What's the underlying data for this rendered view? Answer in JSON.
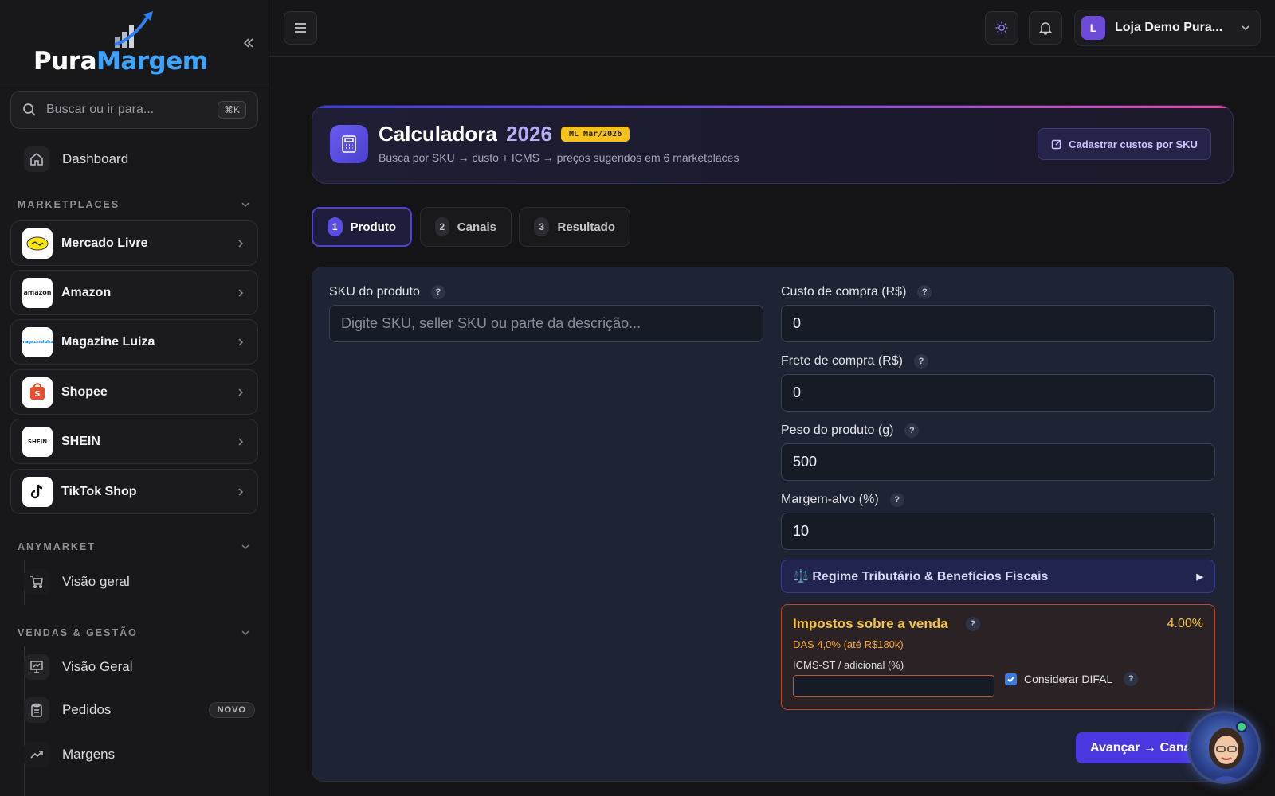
{
  "brand": {
    "part1": "Pura",
    "part2": "Margem"
  },
  "search": {
    "placeholder": "Buscar ou ir para...",
    "shortcut": "⌘K"
  },
  "nav": {
    "dashboard": "Dashboard"
  },
  "sections": {
    "marketplaces": "MARKETPLACES",
    "anymarket": "ANYMARKET",
    "vendas": "VENDAS & GESTÃO"
  },
  "marketplaces": [
    {
      "name": "Mercado Livre",
      "logo": "mercado livre"
    },
    {
      "name": "Amazon",
      "logo": "amazon"
    },
    {
      "name": "Magazine Luiza",
      "logo": "magazineluiza"
    },
    {
      "name": "Shopee",
      "logo": "Shopee"
    },
    {
      "name": "SHEIN",
      "logo": "SHEIN"
    },
    {
      "name": "TikTok Shop",
      "logo": "TikTok"
    }
  ],
  "anymarket_items": [
    {
      "label": "Visão geral"
    }
  ],
  "vendas_items": [
    {
      "label": "Visão Geral"
    },
    {
      "label": "Pedidos",
      "badge": "NOVO"
    },
    {
      "label": "Margens"
    }
  ],
  "topbar": {
    "store_initial": "L",
    "store_name": "Loja Demo Pura..."
  },
  "calc": {
    "title": "Calculadora",
    "year": "2026",
    "badge": "ML Mar/2026",
    "subtitle": "Busca por SKU → custo + ICMS → preços sugeridos em 6 marketplaces",
    "cadastrar": "Cadastrar custos por SKU"
  },
  "steps": [
    {
      "num": "1",
      "label": "Produto"
    },
    {
      "num": "2",
      "label": "Canais"
    },
    {
      "num": "3",
      "label": "Resultado"
    }
  ],
  "form": {
    "sku_label": "SKU do produto",
    "sku_placeholder": "Digite SKU, seller SKU ou parte da descrição...",
    "custo_label": "Custo de compra (R$)",
    "custo_value": "0",
    "frete_label": "Frete de compra (R$)",
    "frete_value": "0",
    "peso_label": "Peso do produto (g)",
    "peso_value": "500",
    "margem_label": "Margem-alvo (%)",
    "margem_value": "10",
    "regime_label": "⚖️ Regime Tributário & Benefícios Fiscais",
    "regime_arrow": "▶",
    "help": "?"
  },
  "impostos": {
    "title": "Impostos sobre a venda",
    "percent": "4.00%",
    "das": "DAS 4,0% (até R$180k)",
    "icms_label": "ICMS-ST / adicional (%)",
    "difal_label": "Considerar DIFAL",
    "difal_checked": true
  },
  "avancar": "Avançar → Canais",
  "colors": {
    "accent": "#4a37e0",
    "warning": "#f4c542",
    "badge": "#f4c21b"
  }
}
